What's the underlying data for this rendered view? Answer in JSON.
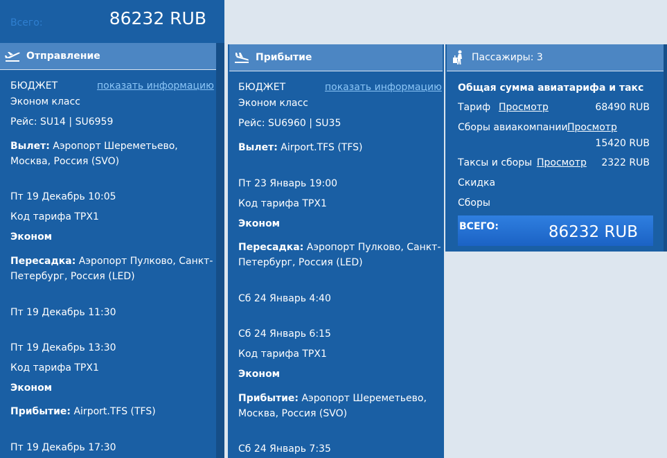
{
  "summary": {
    "total_label": "Всего:",
    "total_value": "86232 RUB"
  },
  "departure": {
    "header": "Отправление",
    "fare_brand": "БЮДЖЕТ",
    "info_link": "показать информацию",
    "class": "Эконом класс",
    "flight": "Рейс: SU14 | SU6959",
    "leg1": {
      "depart_label": "Вылет:",
      "depart_place_1": "Аэропорт Шереметьево,",
      "depart_place_2": "Москва, Россия (SVO)",
      "depart_time": "Пт 19 Декабрь 10:05",
      "fare_code": "Код тарифа TPX1",
      "cabin": "Эконом"
    },
    "transfer": {
      "label": "Пересадка:",
      "place_1": "Аэропорт Пулково, Санкт-",
      "place_2": "Петербург, Россия (LED)",
      "arrive_time": "Пт 19 Декабрь 11:30",
      "depart_time": "Пт 19 Декабрь 13:30",
      "fare_code": "Код тарифа TPX1",
      "cabin": "Эконом"
    },
    "arrival": {
      "label": "Прибытие:",
      "place": "Airport.TFS (TFS)",
      "time": "Пт 19 Декабрь 17:30"
    }
  },
  "return": {
    "header": "Прибытие",
    "fare_brand": "БЮДЖЕТ",
    "info_link": "показать информацию",
    "class": "Эконом класс",
    "flight": "Рейс: SU6960 | SU35",
    "leg1": {
      "depart_label": "Вылет:",
      "depart_place": "Airport.TFS (TFS)",
      "depart_time": "Пт 23 Январь 19:00",
      "fare_code": "Код тарифа TPX1",
      "cabin": "Эконом"
    },
    "transfer": {
      "label": "Пересадка:",
      "place_1": "Аэропорт Пулково, Санкт-",
      "place_2": "Петербург, Россия (LED)",
      "arrive_time": "Сб 24 Январь 4:40",
      "depart_time": "Сб 24 Январь 6:15",
      "fare_code": "Код тарифа TPX1",
      "cabin": "Эконом"
    },
    "arrival": {
      "label": "Прибытие:",
      "place_1": "Аэропорт Шереметьево,",
      "place_2": "Москва, Россия (SVO)",
      "time": "Сб 24 Январь 7:35"
    }
  },
  "passengers": {
    "header": "Пассажиры: 3",
    "section_title": "Общая сумма авиатарифа и такс",
    "fare_label": "Тариф",
    "fare_link": "Просмотр",
    "fare_value": "68490 RUB",
    "carrier_fees_label": "Сборы авиакомпании",
    "carrier_fees_link": "Просмотр",
    "carrier_fees_value": "15420 RUB",
    "taxes_label": "Таксы и сборы",
    "taxes_link": "Просмотр",
    "taxes_value": "2322 RUB",
    "discount_label": "Скидка",
    "fees_label": "Сборы",
    "total_label": "ВСЕГО:",
    "total_value": "86232 RUB"
  },
  "icons": {
    "departure": "plane-takeoff-icon",
    "arrival": "plane-landing-icon",
    "passengers": "traveler-luggage-icon"
  }
}
